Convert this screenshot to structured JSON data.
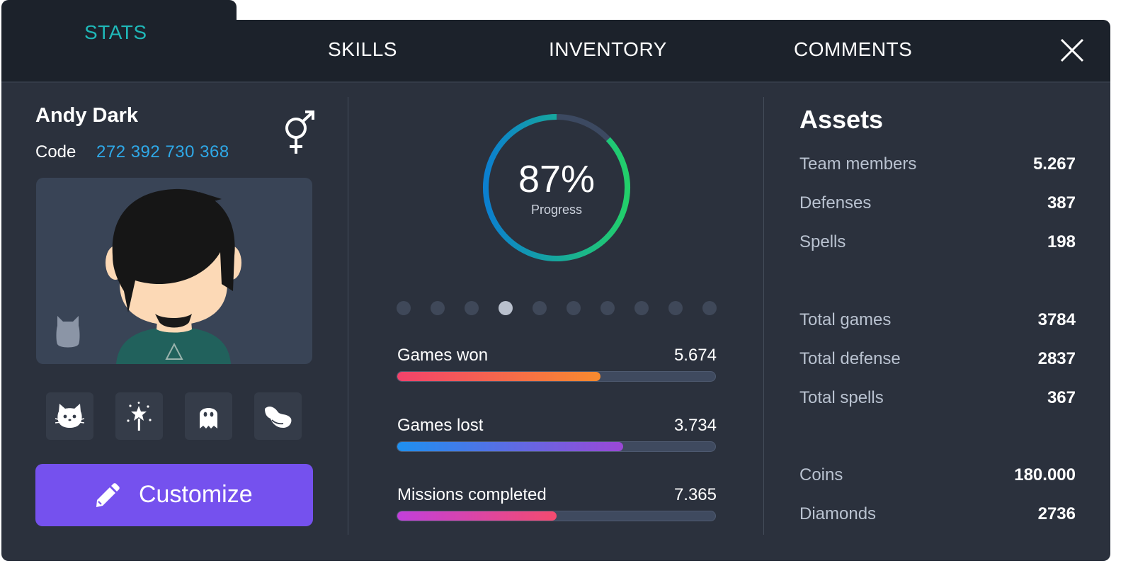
{
  "tabs": {
    "stats": "STATS",
    "skills": "SKILLS",
    "inventory": "INVENTORY",
    "comments": "COMMENTS",
    "active": "stats"
  },
  "player": {
    "name": "Andy Dark",
    "code_label": "Code",
    "code": "272 392 730 368",
    "gender_icon": "male-female-icon",
    "pet_icon": "cat-icon"
  },
  "ability_icons": [
    "cat-icon",
    "magic-wand-icon",
    "ghost-icon",
    "wing-icon"
  ],
  "customize": {
    "label": "Customize",
    "icon": "pencil-icon"
  },
  "progress": {
    "value": "87%",
    "percent": 87,
    "label": "Progress"
  },
  "pagination": {
    "count": 10,
    "active_index": 3
  },
  "stats": [
    {
      "label": "Games won",
      "value": "5.674",
      "fill_percent": 64,
      "colors": [
        "#f2426b",
        "#f88b2e"
      ]
    },
    {
      "label": "Games lost",
      "value": "3.734",
      "fill_percent": 71,
      "colors": [
        "#1e90f0",
        "#9a48d6"
      ]
    },
    {
      "label": "Missions completed",
      "value": "7.365",
      "fill_percent": 50,
      "colors": [
        "#c23fdb",
        "#f44b6f"
      ]
    }
  ],
  "assets": {
    "title": "Assets",
    "groups": [
      [
        {
          "label": "Team members",
          "value": "5.267"
        },
        {
          "label": "Defenses",
          "value": "387"
        },
        {
          "label": "Spells",
          "value": "198"
        }
      ],
      [
        {
          "label": "Total games",
          "value": "3784"
        },
        {
          "label": "Total defense",
          "value": "2837"
        },
        {
          "label": "Total spells",
          "value": "367"
        }
      ],
      [
        {
          "label": "Coins",
          "value": "180.000"
        },
        {
          "label": "Diamonds",
          "value": "2736"
        }
      ]
    ]
  },
  "colors": {
    "accent_teal": "#1fb8b8",
    "code_blue": "#2fa9e8",
    "button_purple": "#7551ee",
    "ring_start": "#1fb8b8",
    "ring_mid": "#0b7fd0",
    "ring_end": "#22d06a"
  }
}
